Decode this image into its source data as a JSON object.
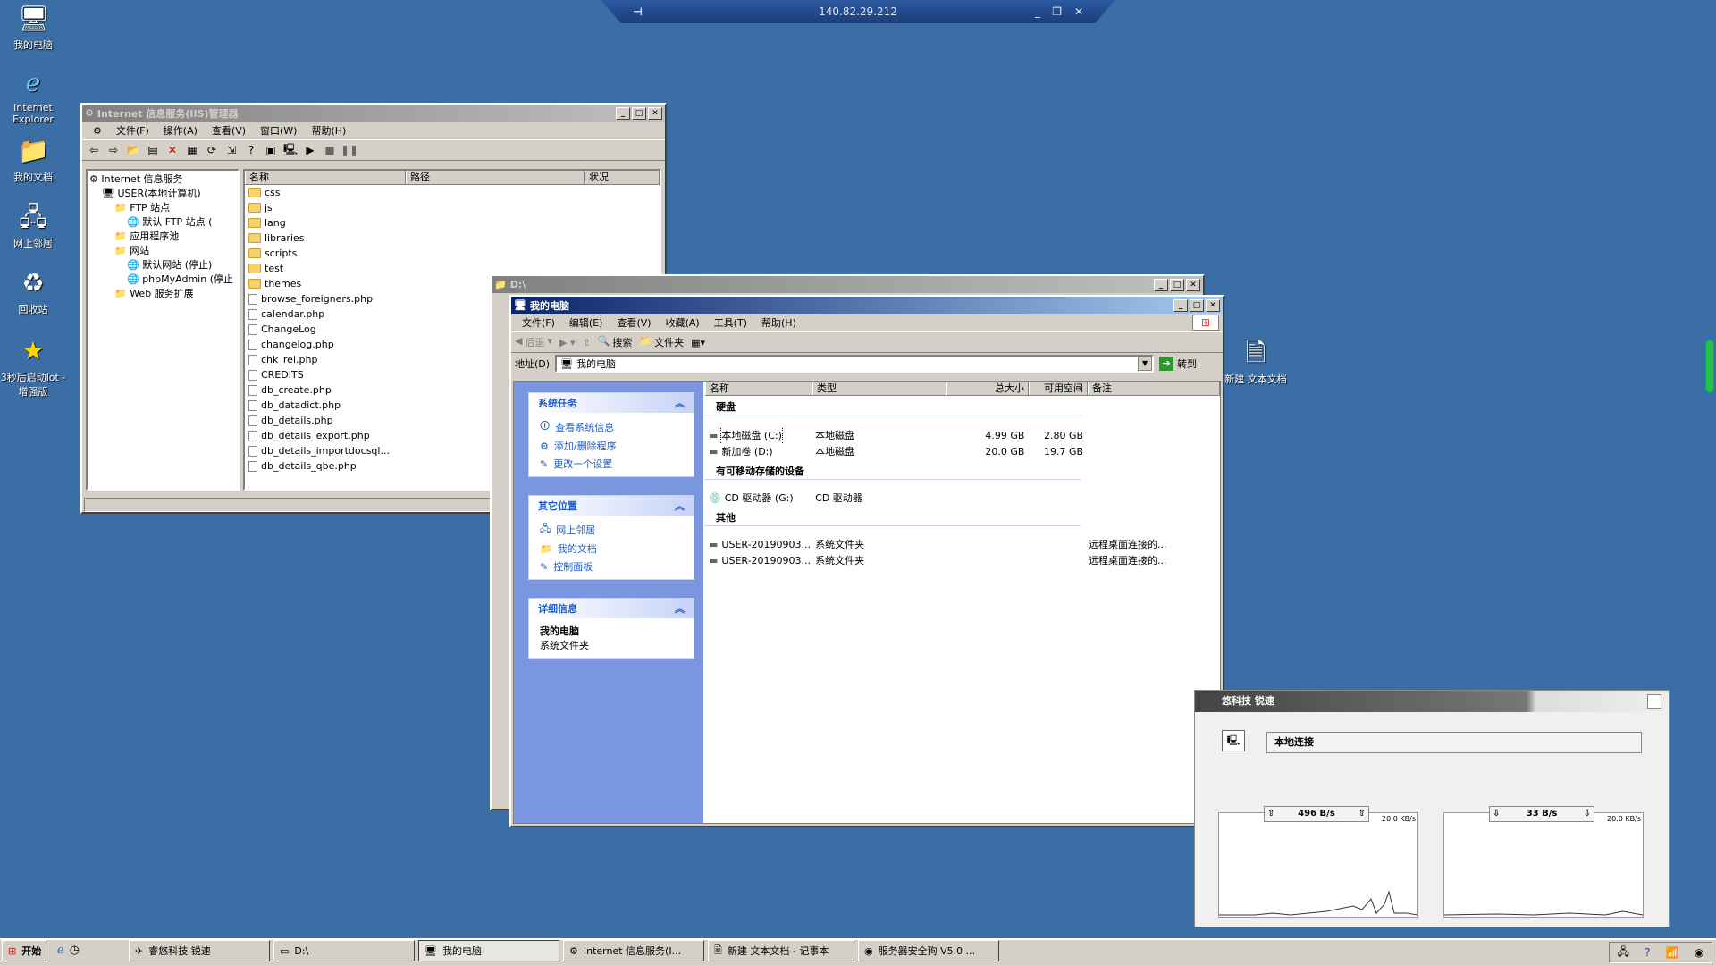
{
  "rdp_bar": {
    "title": "140.82.29.212"
  },
  "desktop_icons": [
    {
      "label": "我的电脑",
      "icon": "computer-icon"
    },
    {
      "label": "Internet Explorer",
      "icon": "ie-icon"
    },
    {
      "label": "我的文档",
      "icon": "documents-icon"
    },
    {
      "label": "网上邻居",
      "icon": "network-icon"
    },
    {
      "label": "回收站",
      "icon": "recycle-bin-icon"
    },
    {
      "label": "3秒后启动lot - 增强版",
      "icon": "star-icon"
    },
    {
      "label": "新建 文本文档",
      "icon": "text-file-icon"
    }
  ],
  "iis": {
    "title": "Internet 信息服务(IIS)管理器",
    "menu": [
      "文件(F)",
      "操作(A)",
      "查看(V)",
      "窗口(W)",
      "帮助(H)"
    ],
    "tree": [
      {
        "label": "Internet 信息服务",
        "level": 0
      },
      {
        "label": "USER(本地计算机)",
        "level": 1
      },
      {
        "label": "FTP 站点",
        "level": 2
      },
      {
        "label": "默认 FTP 站点 (",
        "level": 3
      },
      {
        "label": "应用程序池",
        "level": 2
      },
      {
        "label": "网站",
        "level": 2
      },
      {
        "label": "默认网站 (停止)",
        "level": 3
      },
      {
        "label": "phpMyAdmin (停止",
        "level": 3
      },
      {
        "label": "Web 服务扩展",
        "level": 2
      }
    ],
    "columns": [
      "名称",
      "路径",
      "状况"
    ],
    "files": [
      "css",
      "js",
      "lang",
      "libraries",
      "scripts",
      "test",
      "themes",
      "browse_foreigners.php",
      "calendar.php",
      "ChangeLog",
      "changelog.php",
      "chk_rel.php",
      "CREDITS",
      "db_create.php",
      "db_datadict.php",
      "db_details.php",
      "db_details_export.php",
      "db_details_importdocsql...",
      "db_details_qbe.php"
    ]
  },
  "dwin": {
    "title": "D:\\"
  },
  "mycomputer": {
    "title": "我的电脑",
    "menu": [
      "文件(F)",
      "编辑(E)",
      "查看(V)",
      "收藏(A)",
      "工具(T)",
      "帮助(H)"
    ],
    "back": "后退",
    "search": "搜索",
    "folders": "文件夹",
    "address_label": "地址(D)",
    "address": "我的电脑",
    "go": "转到",
    "panels": [
      {
        "title": "系统任务",
        "links": [
          "查看系统信息",
          "添加/删除程序",
          "更改一个设置"
        ]
      },
      {
        "title": "其它位置",
        "links": [
          "网上邻居",
          "我的文档",
          "控制面板"
        ]
      },
      {
        "title": "详细信息",
        "detail_title": "我的电脑",
        "detail_sub": "系统文件夹"
      }
    ],
    "columns": [
      "名称",
      "类型",
      "总大小",
      "可用空间",
      "备注"
    ],
    "groups": [
      {
        "name": "硬盘",
        "rows": [
          {
            "name": "本地磁盘 (C:)",
            "type": "本地磁盘",
            "total": "4.99 GB",
            "free": "2.80 GB",
            "note": ""
          },
          {
            "name": "新加卷 (D:)",
            "type": "本地磁盘",
            "total": "20.0 GB",
            "free": "19.7 GB",
            "note": ""
          }
        ]
      },
      {
        "name": "有可移动存储的设备",
        "rows": [
          {
            "name": "CD 驱动器 (G:)",
            "type": "CD 驱动器",
            "total": "",
            "free": "",
            "note": ""
          }
        ]
      },
      {
        "name": "其他",
        "rows": [
          {
            "name": "USER-20190903...",
            "type": "系统文件夹",
            "total": "",
            "free": "",
            "note": "远程桌面连接的..."
          },
          {
            "name": "USER-20190903...",
            "type": "系统文件夹",
            "total": "",
            "free": "",
            "note": "远程桌面连接的..."
          }
        ]
      }
    ]
  },
  "netmon": {
    "title": "悠科技 锐速",
    "connection": "本地连接",
    "up_rate": "496 B/s",
    "down_rate": "33 B/s",
    "scale": "20.0 KB/s"
  },
  "taskbar": {
    "start": "开始",
    "tasks": [
      "睿悠科技 锐速",
      "D:\\",
      "我的电脑",
      "Internet 信息服务(I...",
      "新建 文本文档 - 记事本",
      "服务器安全狗 V5.0 ..."
    ]
  }
}
